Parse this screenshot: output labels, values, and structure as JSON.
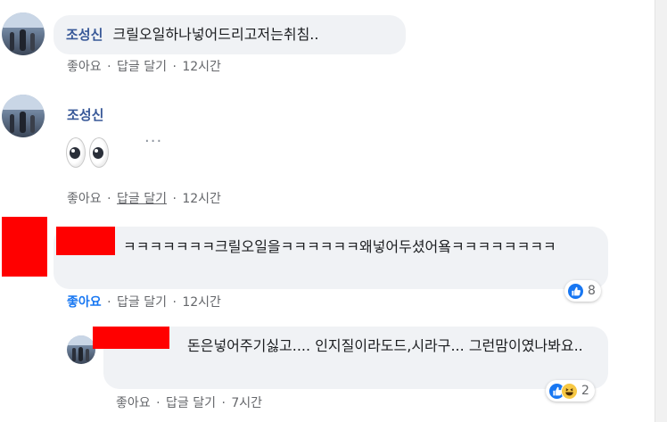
{
  "comments": [
    {
      "author": "조성신",
      "text": "크릴오일하나넣어드리고저는취침..",
      "actions": {
        "like": "좋아요",
        "reply": "답글 달기",
        "time": "12시간"
      }
    },
    {
      "author": "조성신",
      "emoji": "eyes-emoji",
      "more": "···",
      "actions": {
        "like": "좋아요",
        "reply": "답글 달기",
        "time": "12시간"
      }
    },
    {
      "text": "ㅋㅋㅋㅋㅋㅋㅋ크릴오일을ㅋㅋㅋㅋㅋㅋ왜넣어두셨어욬ㅋㅋㅋㅋㅋㅋㅋㅋ",
      "actions": {
        "like": "좋아요",
        "reply": "답글 달기",
        "time": "12시간"
      },
      "reactions": {
        "count": "8",
        "icons": [
          "like-icon"
        ]
      }
    },
    {
      "text": "돈은넣어주기싫고.... 인지질이라도드,시라구... 그런맘이였나봐요..",
      "actions": {
        "like": "좋아요",
        "reply": "답글 달기",
        "time": "7시간"
      },
      "reactions": {
        "count": "2",
        "icons": [
          "like-icon",
          "haha-icon"
        ]
      }
    }
  ],
  "separator": "·",
  "colors": {
    "accent": "#1877f2",
    "author": "#385898",
    "bubble": "#f0f2f5",
    "muted": "#65676b",
    "redaction": "#ff0000"
  }
}
